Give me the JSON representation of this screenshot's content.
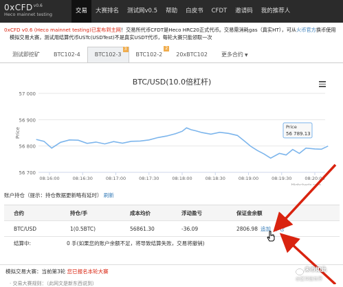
{
  "brand": {
    "name": "0xCFD",
    "version": "v0.6",
    "subtitle": "Heco mainnet testing"
  },
  "nav": {
    "items": [
      "交易",
      "大赛排名",
      "测试网v0.5",
      "帮助",
      "白皮书",
      "CFDT",
      "邀请码",
      "我的推荐人"
    ],
    "active": 0
  },
  "notice": {
    "line1_red": "0xCFD v0.6 (Heco mainnet testing)已发布到主网",
    "line1_rest": "！交易所代币CFDT是Heco HRC20正式代币。交易需消耗gas（真实HT），可从",
    "line1_link": "火币官方",
    "line1_tail": "换币使用",
    "line2": "模拟交易大赛，测试用结算代币USTc(USDTest)不是真实USDT代币，每轮大赛只能领取一次"
  },
  "tabs": [
    {
      "label": "测试即挖矿",
      "badge": ""
    },
    {
      "label": "BTC102-4",
      "badge": ""
    },
    {
      "label": "BTC102-3",
      "badge": "3",
      "active": true
    },
    {
      "label": "BTC102-2",
      "badge": "2"
    },
    {
      "label": "20xBTC102",
      "badge": ""
    },
    {
      "label": "更多合约",
      "badge": "",
      "dropdown": true
    }
  ],
  "chart_data": {
    "type": "line",
    "title": "BTC/USD(10.0倍杠杆)",
    "ylabel": "Price",
    "xlabel": "",
    "ylim": [
      56700,
      57000
    ],
    "y_ticks": [
      57000,
      56900,
      56800,
      56700
    ],
    "x_ticks": [
      "08:16:00",
      "08:16:30",
      "08:17:00",
      "08:17:30",
      "08:18:00",
      "08:18:30",
      "08:19:00",
      "08:19:30",
      "08:20:00"
    ],
    "credits": "Highcharts.com",
    "tooltip": {
      "label": "Price",
      "value": "56 789.13"
    },
    "series": [
      {
        "color": "#7cb5ec",
        "x": [
          "08:15:48",
          "08:15:55",
          "08:16:02",
          "08:16:10",
          "08:16:18",
          "08:16:26",
          "08:16:34",
          "08:16:42",
          "08:16:50",
          "08:16:58",
          "08:17:06",
          "08:17:14",
          "08:17:22",
          "08:17:30",
          "08:17:38",
          "08:17:46",
          "08:17:54",
          "08:18:00",
          "08:18:04",
          "08:18:08",
          "08:18:12",
          "08:18:18",
          "08:18:26",
          "08:18:34",
          "08:18:42",
          "08:18:50",
          "08:18:56",
          "08:19:02",
          "08:19:08",
          "08:19:14",
          "08:19:20",
          "08:19:28",
          "08:19:34",
          "08:19:40",
          "08:19:46",
          "08:19:52",
          "08:20:00",
          "08:20:06",
          "08:20:12"
        ],
        "values": [
          56825,
          56818,
          56792,
          56814,
          56823,
          56822,
          56810,
          56815,
          56808,
          56817,
          56811,
          56818,
          56819,
          56823,
          56832,
          56838,
          56847,
          56856,
          56869,
          56862,
          56858,
          56851,
          56845,
          56852,
          56848,
          56840,
          56820,
          56799,
          56783,
          56770,
          56754,
          56772,
          56766,
          56787,
          56772,
          56792,
          56789,
          56788,
          56800
        ]
      }
    ]
  },
  "positions": {
    "heading": "账户持仓（提示：持仓数据更新略有延时）",
    "refresh": "刷新",
    "columns": [
      "合约",
      "持仓/手",
      "成本均价",
      "浮动盈亏",
      "保证金余额"
    ],
    "row": {
      "contract": "BTC/USD",
      "qty": "1(0.5BTC)",
      "avg_cost": "56861.30",
      "pnl": "-36.09",
      "margin": "2806.98",
      "action_add": "追加",
      "action_close": "平仓"
    },
    "result_label": "结算中:",
    "result_value": "0 手(如果您的账户余额不足，将导致结算失败，交易将撤销)"
  },
  "contest": {
    "prefix": "模拟交易大赛：当前第3轮",
    "link": "您已报名本轮大赛",
    "cut_line": "· 交易大赛规则：（此网文是新东西说到）"
  },
  "watermark": {
    "text": "未币如此",
    "sub": "@区块链世界"
  }
}
